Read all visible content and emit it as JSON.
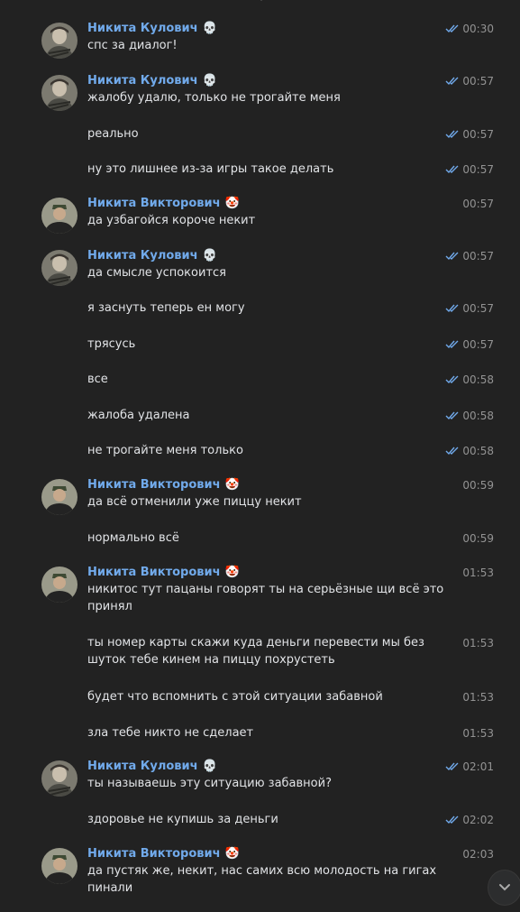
{
  "authors": {
    "kulovich": {
      "name": "Никита Кулович",
      "emoji": "💀"
    },
    "viktorovich": {
      "name": "Никита Викторович",
      "emoji": "🤡"
    }
  },
  "messages": [
    {
      "author": "kulovich",
      "text": "спс за диалог!",
      "time": "00:30",
      "read": true
    },
    {
      "author": "kulovich",
      "text": "жалобу удалю, только не трогайте меня",
      "time": "00:57",
      "read": true
    },
    {
      "text": "реально",
      "time": "00:57",
      "read": true
    },
    {
      "text": "ну это лишнее из-за игры такое делать",
      "time": "00:57",
      "read": true
    },
    {
      "author": "viktorovich",
      "text": "да узбагойся короче некит",
      "time": "00:57",
      "read": false
    },
    {
      "author": "kulovich",
      "text": "да смысле успокоится",
      "time": "00:57",
      "read": true
    },
    {
      "text": "я заснуть теперь ен могу",
      "time": "00:57",
      "read": true
    },
    {
      "text": "трясусь",
      "time": "00:57",
      "read": true
    },
    {
      "text": "все",
      "time": "00:58",
      "read": true
    },
    {
      "text": "жалоба удалена",
      "time": "00:58",
      "read": true
    },
    {
      "text": "не трогайте меня только",
      "time": "00:58",
      "read": true
    },
    {
      "author": "viktorovich",
      "text": "да всё отменили уже пиццу некит",
      "time": "00:59",
      "read": false
    },
    {
      "text": "нормально всё",
      "time": "00:59",
      "read": false
    },
    {
      "author": "viktorovich",
      "text": "никитос тут пацаны говорят ты на серьёзные щи всё это принял",
      "time": "01:53",
      "read": false
    },
    {
      "text": "ты номер карты скажи куда деньги перевести мы без шуток тебе кинем на пиццу похрустеть",
      "time": "01:53",
      "read": false
    },
    {
      "text": "будет что вспомнить с этой ситуации забавной",
      "time": "01:53",
      "read": false
    },
    {
      "text": "зла тебе никто не сделает",
      "time": "01:53",
      "read": false
    },
    {
      "author": "kulovich",
      "text": "ты называешь эту ситуацию забавной?",
      "time": "02:01",
      "read": true
    },
    {
      "text": "здоровье не купишь за деньги",
      "time": "02:02",
      "read": true
    },
    {
      "author": "viktorovich",
      "text": "да пустяк же, некит, нас самих всю молодость на гигах пинали",
      "time": "02:03",
      "read": false
    }
  ],
  "icons": {
    "scroll_down": "chevron-down-icon",
    "read_status": "double-check-icon"
  },
  "colors": {
    "background": "#222222",
    "author_name": "#71aaeb",
    "text": "#e1e3e6",
    "time": "#939393",
    "check": "#71aaeb"
  }
}
